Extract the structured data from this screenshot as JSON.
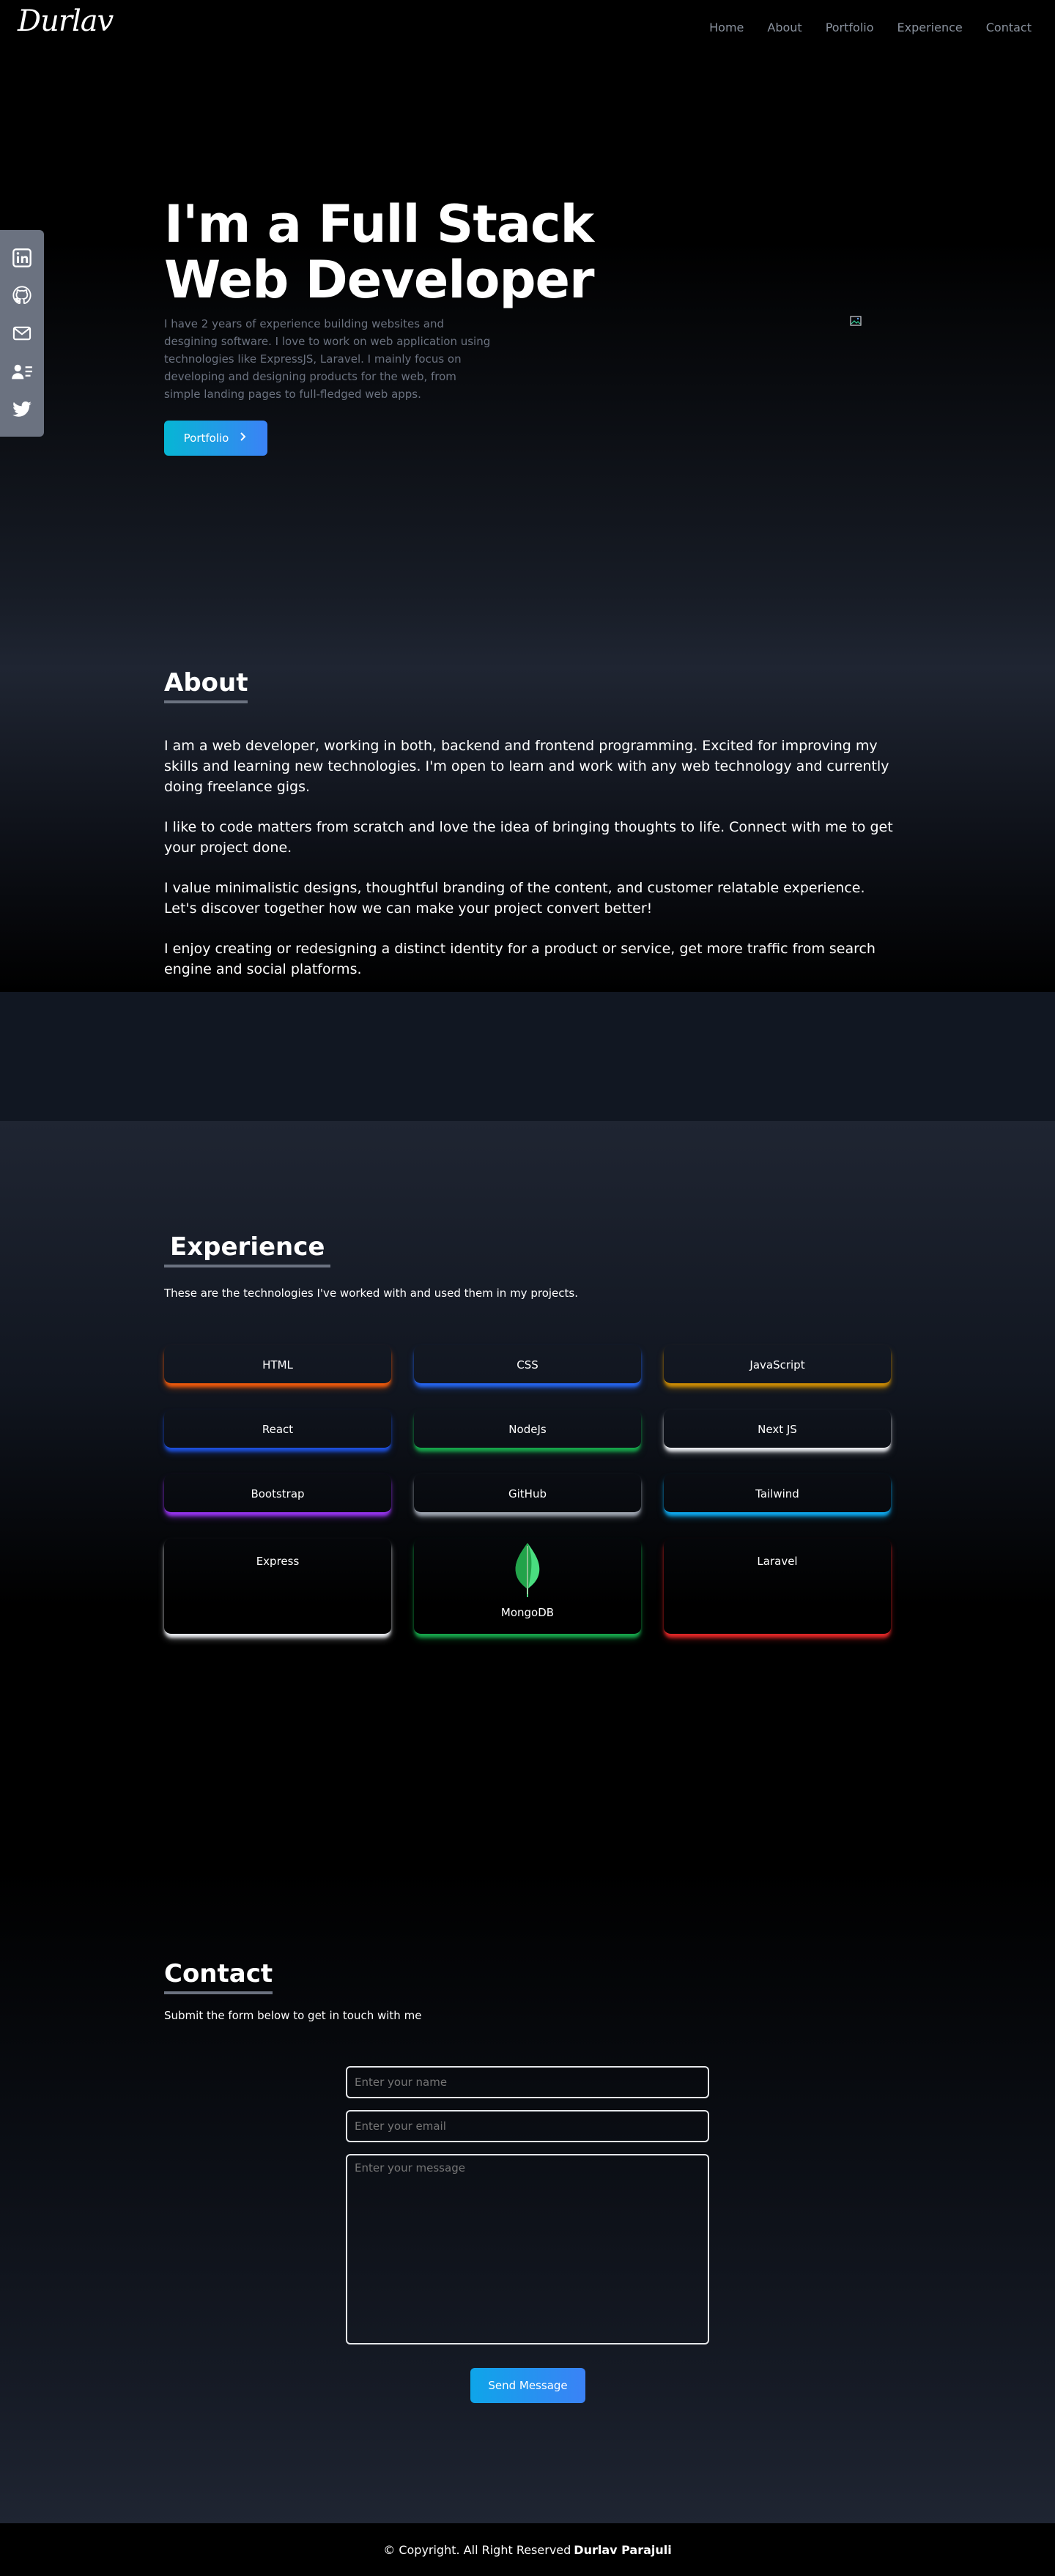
{
  "nav": {
    "logo": "Durlav",
    "links": [
      "Home",
      "About",
      "Portfolio",
      "Experience",
      "Contact"
    ]
  },
  "social": {
    "icons": [
      "linkedin-icon",
      "github-icon",
      "mail-icon",
      "resume-icon",
      "twitter-icon"
    ]
  },
  "hero": {
    "title": "I'm a Full Stack Web Developer",
    "description": "I have 2 years of experience building websites and desgining software. I love to work on web application using technologies like ExpressJS, Laravel. I mainly focus on developing and designing products for the web, from simple landing pages to full-fledged web apps.",
    "button_label": "Portfolio"
  },
  "about": {
    "title": "About",
    "paragraphs": [
      "I am a web developer, working in both, backend and frontend programming. Excited for improving my skills and learning new technologies. I'm open to learn and work with any web technology and currently doing freelance gigs.",
      "I like to code matters from scratch and love the idea of bringing thoughts to life. Connect with me to get your project done.",
      "I value minimalistic designs, thoughtful branding of the content, and customer relatable experience. Let's discover together how we can make your project convert better!",
      "I enjoy creating or redesigning a distinct identity for a product or service, get more traffic from search engine and social platforms."
    ]
  },
  "experience": {
    "title": "Experience",
    "subtitle": "These are the technologies I've worked with and used them in my projects.",
    "technologies": [
      {
        "name": "HTML",
        "color": "#ea580c"
      },
      {
        "name": "CSS",
        "color": "#2563eb"
      },
      {
        "name": "JavaScript",
        "color": "#ca8a04"
      },
      {
        "name": "React",
        "color": "#1d4ed8"
      },
      {
        "name": "NodeJs",
        "color": "#16a34a"
      },
      {
        "name": "Next JS",
        "color": "#e5e7eb"
      },
      {
        "name": "Bootstrap",
        "color": "#9333ea"
      },
      {
        "name": "GitHub",
        "color": "#9ca3af"
      },
      {
        "name": "Tailwind",
        "color": "#0ea5e9"
      },
      {
        "name": "Express",
        "color": "#e5e7eb"
      },
      {
        "name": "MongoDB",
        "color": "#16a34a"
      },
      {
        "name": "Laravel",
        "color": "#dc2626"
      }
    ]
  },
  "contact": {
    "title": "Contact",
    "subtitle": "Submit the form below to get in touch with me",
    "name_placeholder": "Enter your name",
    "email_placeholder": "Enter your email",
    "message_placeholder": "Enter your message",
    "send_label": "Send Message"
  },
  "footer": {
    "text": "© Copyright. All Right Reserved",
    "author": "Durlav Parajuli"
  }
}
